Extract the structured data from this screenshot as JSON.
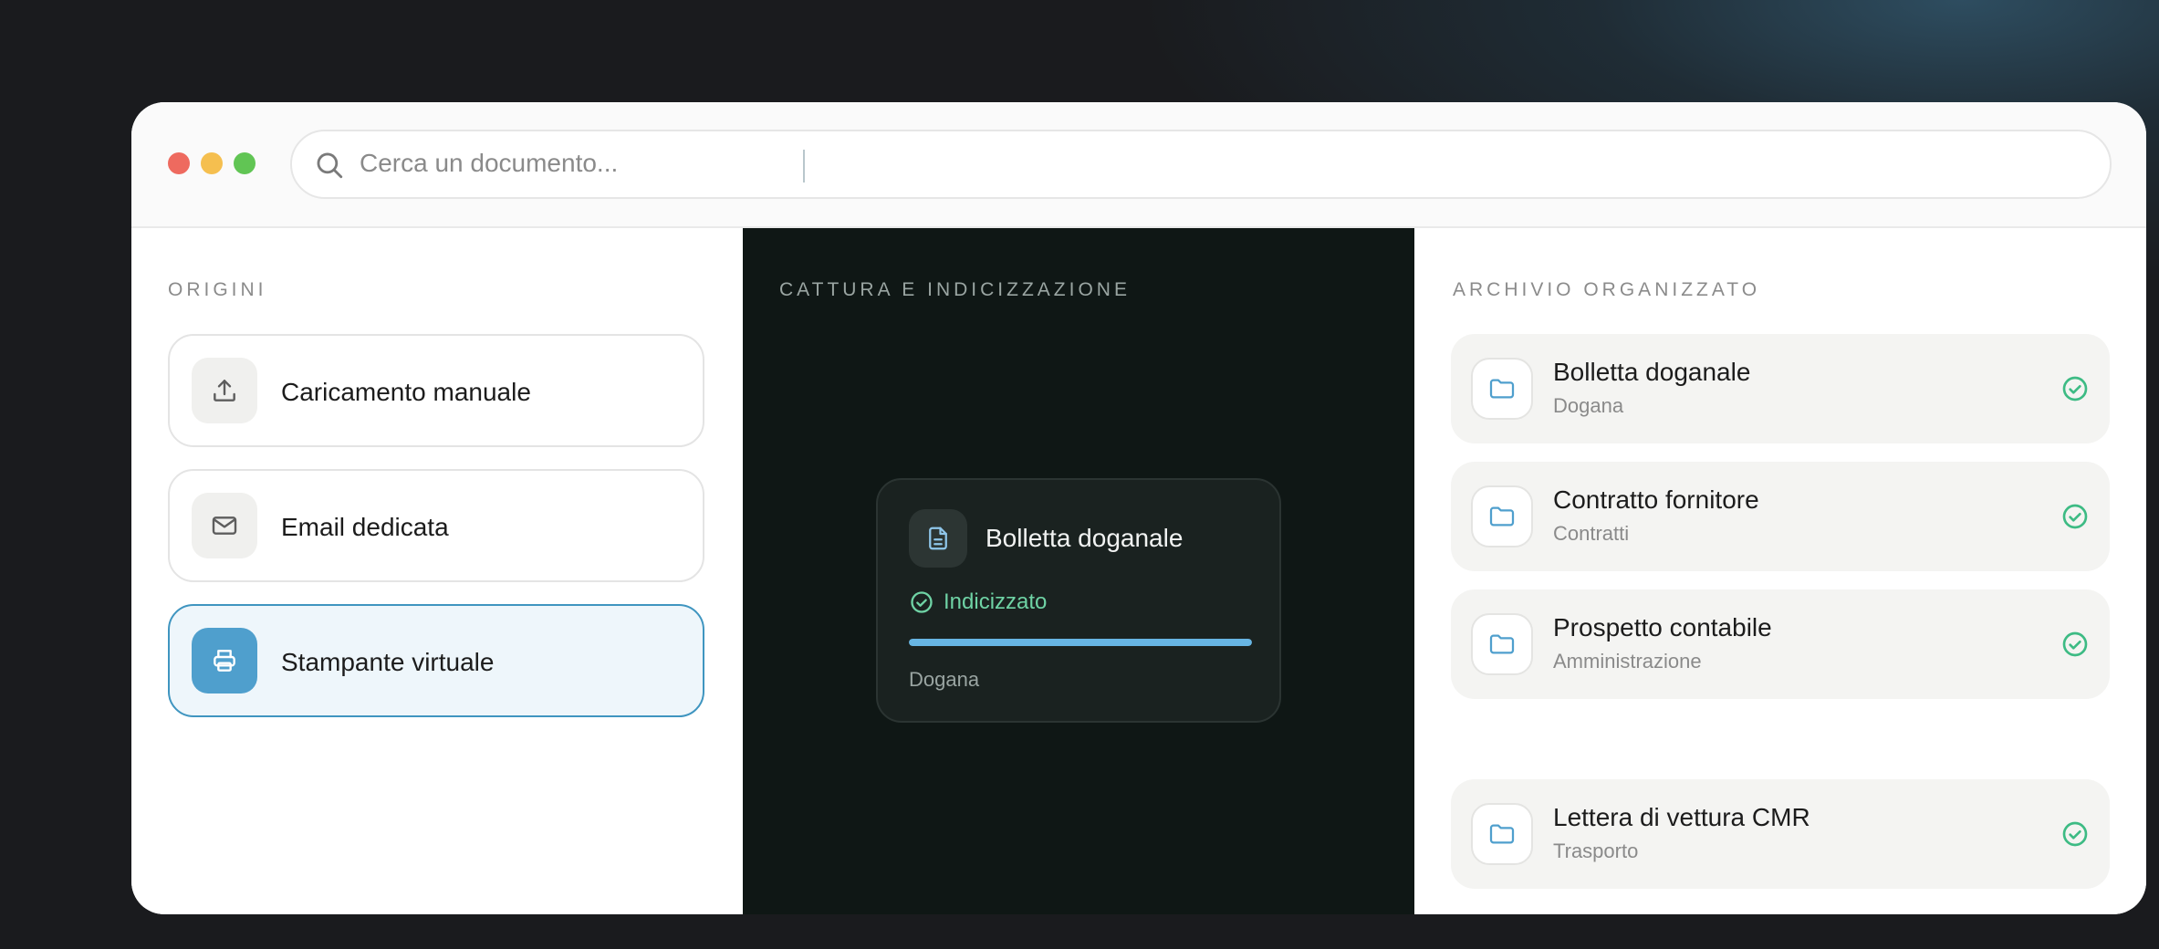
{
  "search": {
    "placeholder": "Cerca un documento..."
  },
  "origins": {
    "label": "ORIGINI",
    "items": [
      {
        "label": "Caricamento manuale",
        "icon": "upload-icon",
        "active": false
      },
      {
        "label": "Email dedicata",
        "icon": "mail-icon",
        "active": false
      },
      {
        "label": "Stampante virtuale",
        "icon": "printer-icon",
        "active": true
      }
    ]
  },
  "capture": {
    "label": "CATTURA E INDICIZZAZIONE",
    "card": {
      "title": "Bolletta doganale",
      "status": "Indicizzato",
      "progress": 1.0,
      "category": "Dogana"
    }
  },
  "archive": {
    "label": "ARCHIVIO ORGANIZZATO",
    "items": [
      {
        "title": "Bolletta doganale",
        "category": "Dogana"
      },
      {
        "title": "Contratto fornitore",
        "category": "Contratti"
      },
      {
        "title": "Prospetto contabile",
        "category": "Amministrazione"
      },
      {
        "title": "Lettera di vettura CMR",
        "category": "Trasporto"
      }
    ]
  },
  "colors": {
    "accent": "#4f9fcd",
    "success": "#3dbb84",
    "mid_bg": "#0f1715"
  }
}
